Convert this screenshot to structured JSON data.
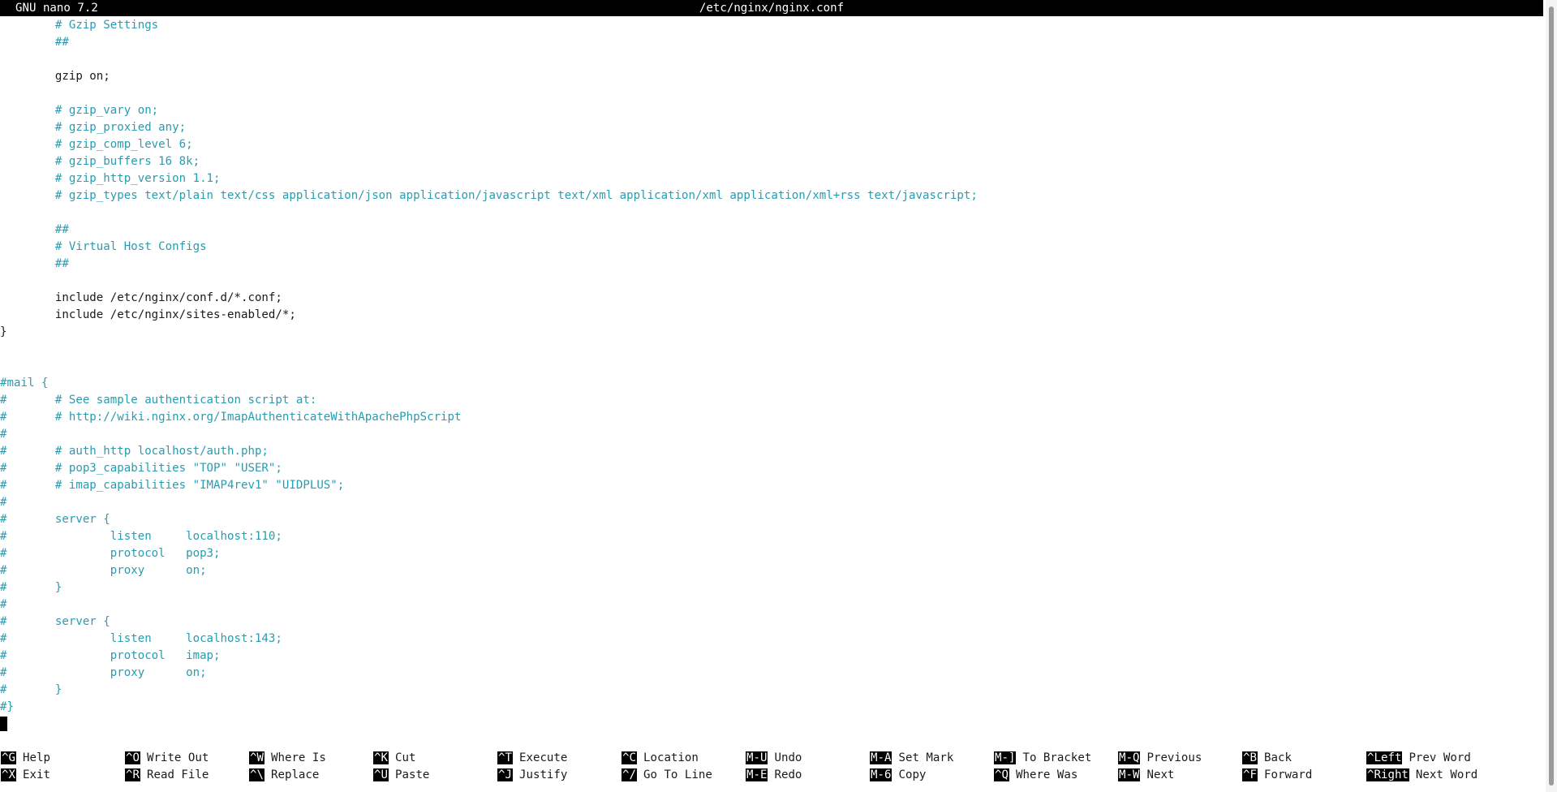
{
  "app_title": "GNU nano 7.2",
  "file_name": "/etc/nginx/nginx.conf",
  "editor_lines": [
    {
      "text": "        # Gzip Settings",
      "comment": true
    },
    {
      "text": "        ##",
      "comment": true
    },
    {
      "text": "",
      "comment": false
    },
    {
      "text": "        gzip on;",
      "comment": false
    },
    {
      "text": "",
      "comment": false
    },
    {
      "text": "        # gzip_vary on;",
      "comment": true
    },
    {
      "text": "        # gzip_proxied any;",
      "comment": true
    },
    {
      "text": "        # gzip_comp_level 6;",
      "comment": true
    },
    {
      "text": "        # gzip_buffers 16 8k;",
      "comment": true
    },
    {
      "text": "        # gzip_http_version 1.1;",
      "comment": true
    },
    {
      "text": "        # gzip_types text/plain text/css application/json application/javascript text/xml application/xml application/xml+rss text/javascript;",
      "comment": true
    },
    {
      "text": "",
      "comment": false
    },
    {
      "text": "        ##",
      "comment": true
    },
    {
      "text": "        # Virtual Host Configs",
      "comment": true
    },
    {
      "text": "        ##",
      "comment": true
    },
    {
      "text": "",
      "comment": false
    },
    {
      "text": "        include /etc/nginx/conf.d/*.conf;",
      "comment": false
    },
    {
      "text": "        include /etc/nginx/sites-enabled/*;",
      "comment": false
    },
    {
      "text": "}",
      "comment": false
    },
    {
      "text": "",
      "comment": false
    },
    {
      "text": "",
      "comment": false
    },
    {
      "text": "#mail {",
      "comment": true
    },
    {
      "text": "#       # See sample authentication script at:",
      "comment": true
    },
    {
      "text": "#       # http://wiki.nginx.org/ImapAuthenticateWithApachePhpScript",
      "comment": true
    },
    {
      "text": "#",
      "comment": true
    },
    {
      "text": "#       # auth_http localhost/auth.php;",
      "comment": true
    },
    {
      "text": "#       # pop3_capabilities \"TOP\" \"USER\";",
      "comment": true
    },
    {
      "text": "#       # imap_capabilities \"IMAP4rev1\" \"UIDPLUS\";",
      "comment": true
    },
    {
      "text": "#",
      "comment": true
    },
    {
      "text": "#       server {",
      "comment": true
    },
    {
      "text": "#               listen     localhost:110;",
      "comment": true
    },
    {
      "text": "#               protocol   pop3;",
      "comment": true
    },
    {
      "text": "#               proxy      on;",
      "comment": true
    },
    {
      "text": "#       }",
      "comment": true
    },
    {
      "text": "#",
      "comment": true
    },
    {
      "text": "#       server {",
      "comment": true
    },
    {
      "text": "#               listen     localhost:143;",
      "comment": true
    },
    {
      "text": "#               protocol   imap;",
      "comment": true
    },
    {
      "text": "#               proxy      on;",
      "comment": true
    },
    {
      "text": "#       }",
      "comment": true
    },
    {
      "text": "#}",
      "comment": true
    }
  ],
  "shortcuts": [
    [
      {
        "key": "^G",
        "label": "Help"
      },
      {
        "key": "^O",
        "label": "Write Out"
      },
      {
        "key": "^W",
        "label": "Where Is"
      },
      {
        "key": "^K",
        "label": "Cut"
      },
      {
        "key": "^T",
        "label": "Execute"
      },
      {
        "key": "^C",
        "label": "Location"
      },
      {
        "key": "M-U",
        "label": "Undo"
      },
      {
        "key": "M-A",
        "label": "Set Mark"
      },
      {
        "key": "M-]",
        "label": "To Bracket"
      },
      {
        "key": "M-Q",
        "label": "Previous"
      },
      {
        "key": "^B",
        "label": "Back"
      },
      {
        "key": "^Left",
        "label": "Prev Word"
      }
    ],
    [
      {
        "key": "^X",
        "label": "Exit"
      },
      {
        "key": "^R",
        "label": "Read File"
      },
      {
        "key": "^\\",
        "label": "Replace"
      },
      {
        "key": "^U",
        "label": "Paste"
      },
      {
        "key": "^J",
        "label": "Justify"
      },
      {
        "key": "^/",
        "label": "Go To Line"
      },
      {
        "key": "M-E",
        "label": "Redo"
      },
      {
        "key": "M-6",
        "label": "Copy"
      },
      {
        "key": "^Q",
        "label": "Where Was"
      },
      {
        "key": "M-W",
        "label": "Next"
      },
      {
        "key": "^F",
        "label": "Forward"
      },
      {
        "key": "^Right",
        "label": "Next Word"
      }
    ]
  ]
}
